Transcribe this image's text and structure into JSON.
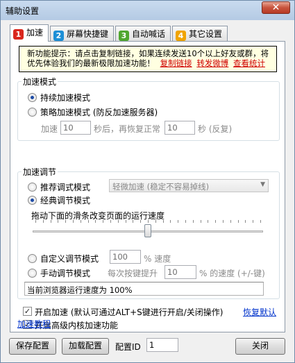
{
  "window": {
    "title": "辅助设置",
    "close_glyph": "✕"
  },
  "tabs": [
    {
      "num": "1",
      "label": "加速",
      "color": "#d9261c"
    },
    {
      "num": "2",
      "label": "屏幕快捷键",
      "color": "#1d8fd6"
    },
    {
      "num": "3",
      "label": "自动喊话",
      "color": "#4fa62f"
    },
    {
      "num": "4",
      "label": "其它设置",
      "color": "#f0a400"
    }
  ],
  "notice": {
    "line1": "新功能提示：请点击复制链接，如果连续发送10个以上好友或群，将",
    "line2": "优先体验我们的最新极限加速功能！",
    "links": [
      "复制链接",
      "转发微博",
      "查看统计"
    ]
  },
  "mode_group": {
    "label": "加速模式",
    "continuous": "持续加速模式",
    "strategy": "策略加速模式 (防反加速服务器)",
    "accel_prefix": "加速",
    "accel_value": "10",
    "accel_mid": "秒后，再恢复正常",
    "restore_value": "10",
    "accel_suffix": "秒  (反复)"
  },
  "tune_group": {
    "label": "加速调节",
    "recommended": "推荐调式模式",
    "recommended_select": "轻微加速 (稳定不容易掉线)",
    "classic": "经典调节模式",
    "slider_hint": "拖动下面的滑条改变页面的运行速度",
    "slider_value": 0.5,
    "custom": "自定义调节模式",
    "custom_value": "100",
    "custom_suffix": "% 速度",
    "manual": "手动调节模式",
    "manual_mid": "每次按键提升",
    "manual_value": "10",
    "manual_suffix": "% 的速度 (+/-键)",
    "status": "当前浏览器运行速度为 100%"
  },
  "options": {
    "enable": "开启加速 (默认可通过ALT+S键进行开启/关闭操作)",
    "restore_default": "恢复默认",
    "kernel": "开启高级内核加速功能",
    "tutorial": "加速教程"
  },
  "footer": {
    "save": "保存配置",
    "load": "加载配置",
    "config_id_label": "配置ID",
    "config_id_value": "1",
    "close": "关闭"
  }
}
